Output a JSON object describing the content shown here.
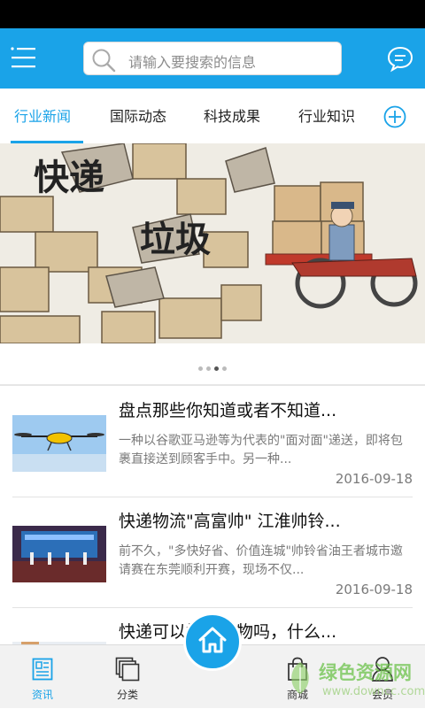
{
  "search": {
    "placeholder": "请输入要搜索的信息"
  },
  "tabs": [
    {
      "label": "行业新闻",
      "active": true
    },
    {
      "label": "国际动态"
    },
    {
      "label": "科技成果"
    },
    {
      "label": "行业知识"
    }
  ],
  "banner": {
    "caption_line1": "快递",
    "caption_line2": "垃圾",
    "pager": {
      "count": 4,
      "current": 3
    }
  },
  "news": [
    {
      "title": "盘点那些你知道或者不知道...",
      "desc": "一种以谷歌亚马逊等为代表的\"面对面\"递送，即将包裹直接送到顾客手中。另一种...",
      "date": "2016-09-18"
    },
    {
      "title": "快递物流\"高富帅\" 江淮帅铃...",
      "desc": "前不久，\"多快好省、价值连城\"帅铃省油王者城市邀请赛在东莞顺利开赛，现场不仅...",
      "date": "2016-09-18"
    },
    {
      "title": "快递可以托运宠物吗，什么...",
      "desc": "",
      "date": ""
    }
  ],
  "bottom_nav": [
    {
      "label": "资讯",
      "icon": "news-icon",
      "active": true
    },
    {
      "label": "分类",
      "icon": "category-icon"
    },
    {
      "label": "",
      "icon": "home-icon"
    },
    {
      "label": "商城",
      "icon": "shopping-bag-icon"
    },
    {
      "label": "会员",
      "icon": "user-icon"
    }
  ],
  "watermark": {
    "text": "绿色资源网",
    "url": "www.downcc.com"
  },
  "colors": {
    "brand": "#1aa3e8",
    "tab_active": "#1aa3e8",
    "watermark": "#6cc24a"
  }
}
